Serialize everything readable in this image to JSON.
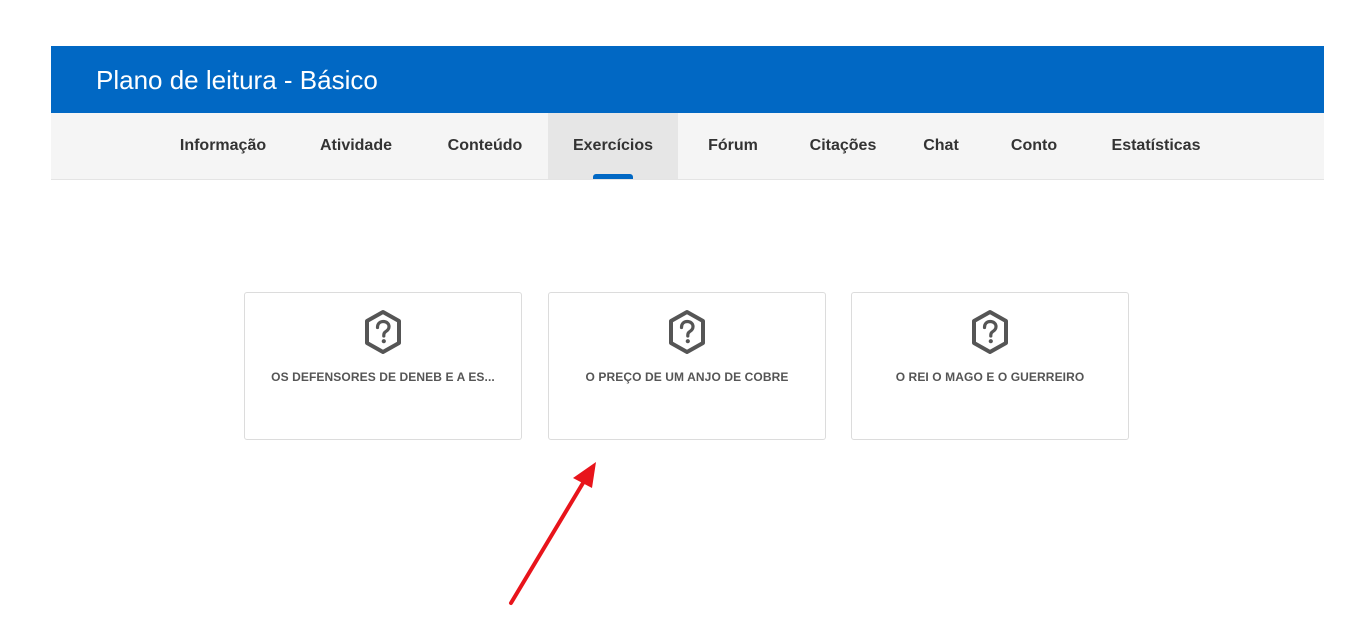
{
  "header": {
    "title": "Plano de leitura - Básico"
  },
  "tabs": [
    {
      "label": "Informação",
      "active": false
    },
    {
      "label": "Atividade",
      "active": false
    },
    {
      "label": "Conteúdo",
      "active": false
    },
    {
      "label": "Exercícios",
      "active": true
    },
    {
      "label": "Fórum",
      "active": false
    },
    {
      "label": "Citações",
      "active": false
    },
    {
      "label": "Chat",
      "active": false
    },
    {
      "label": "Conto",
      "active": false
    },
    {
      "label": "Estatísticas",
      "active": false
    }
  ],
  "cards": [
    {
      "title": "OS DEFENSORES DE DENEB E A ES...",
      "icon": "question-hexagon-icon"
    },
    {
      "title": "O PREÇO DE UM ANJO DE COBRE",
      "icon": "question-hexagon-icon"
    },
    {
      "title": "O REI O MAGO E O GUERREIRO",
      "icon": "question-hexagon-icon"
    }
  ],
  "colors": {
    "brand": "#0168c4",
    "annotation_arrow": "#e8141b"
  }
}
